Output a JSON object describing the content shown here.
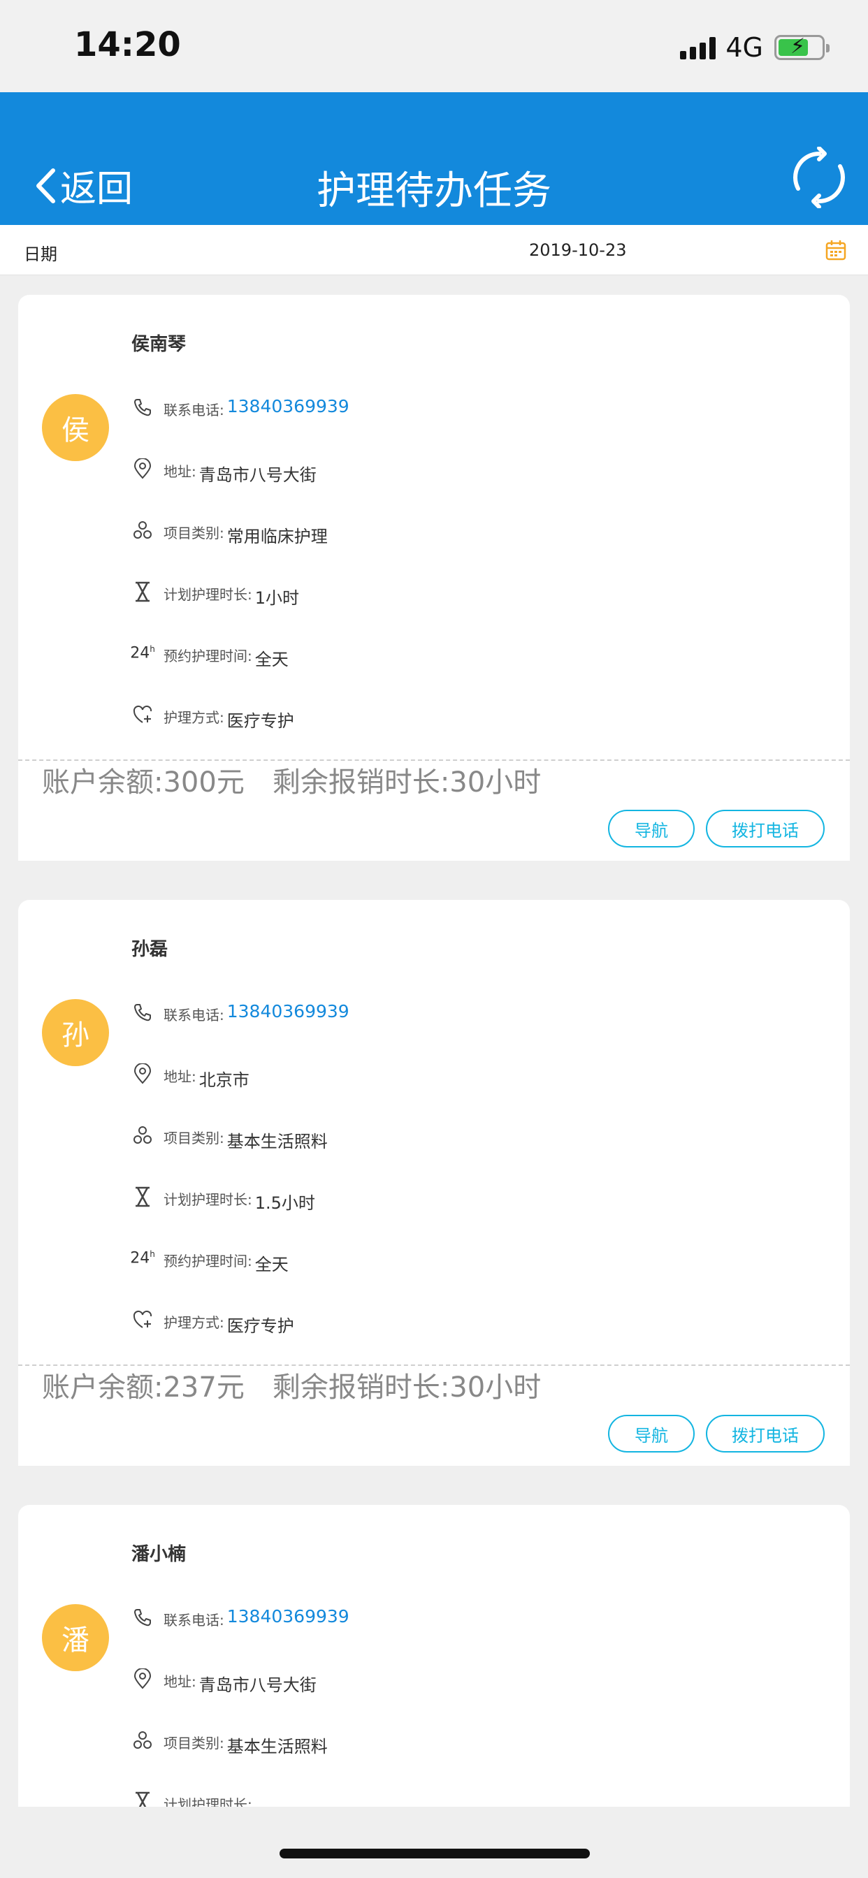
{
  "status": {
    "time": "14:20",
    "network": "4G"
  },
  "nav": {
    "back_label": "返回",
    "title": "护理待办任务"
  },
  "date_bar": {
    "label": "日期",
    "value": "2019-10-23"
  },
  "labels": {
    "phone": "联系电话:",
    "address": "地址:",
    "category": "项目类别:",
    "duration": "计划护理时长:",
    "appointment": "预约护理时间:",
    "mode": "护理方式:",
    "navigate_button": "导航",
    "call_button": "拨打电话"
  },
  "tasks": [
    {
      "avatar": "侯",
      "name": "侯南琴",
      "phone": "13840369939",
      "address": "青岛市八号大街",
      "category": "常用临床护理",
      "duration": "1小时",
      "appointment": "全天",
      "mode": "医疗专护",
      "balance": "账户余额:300元",
      "remaining": "剩余报销时长:30小时"
    },
    {
      "avatar": "孙",
      "name": "孙磊",
      "phone": "13840369939",
      "address": "北京市",
      "category": "基本生活照料",
      "duration": "1.5小时",
      "appointment": "全天",
      "mode": "医疗专护",
      "balance": "账户余额:237元",
      "remaining": "剩余报销时长:30小时"
    },
    {
      "avatar": "潘",
      "name": "潘小楠",
      "phone": "13840369939",
      "address": "青岛市八号大街",
      "category": "基本生活照料",
      "duration": "",
      "appointment": "",
      "mode": "",
      "balance": "",
      "remaining": ""
    }
  ],
  "colors": {
    "primary": "#1389dc",
    "avatar": "#fbbf44",
    "button": "#13b5e1",
    "calendar": "#f5a623"
  },
  "icons": [
    "back-chevron-icon",
    "refresh-icon",
    "calendar-icon",
    "phone-icon",
    "location-icon",
    "category-icon",
    "hourglass-icon",
    "24h-icon",
    "heart-plus-icon"
  ]
}
